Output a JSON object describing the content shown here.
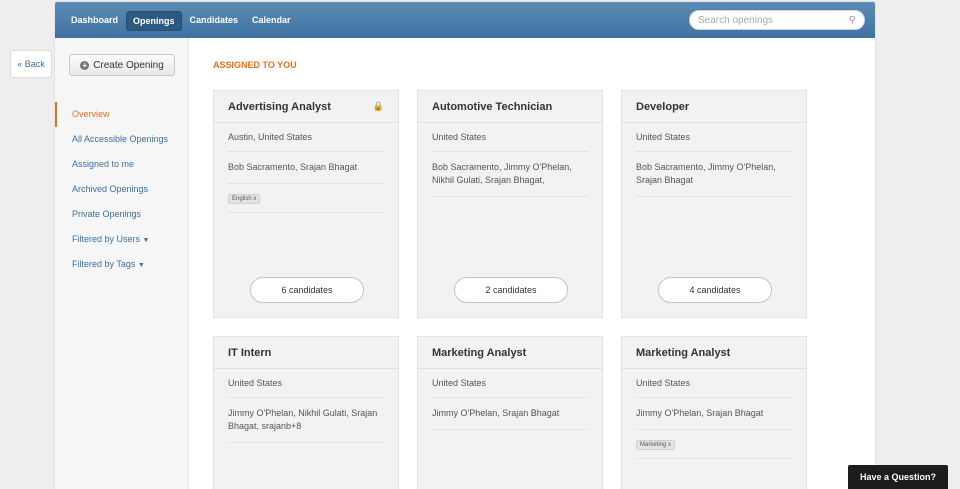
{
  "back_label": "« Back",
  "nav": {
    "items": [
      {
        "label": "Dashboard"
      },
      {
        "label": "Openings"
      },
      {
        "label": "Candidates"
      },
      {
        "label": "Calendar"
      }
    ],
    "active": "Openings",
    "search_placeholder": "Search openings"
  },
  "sidebar": {
    "create_label": "Create Opening",
    "items": [
      {
        "label": "Overview"
      },
      {
        "label": "All Accessible Openings"
      },
      {
        "label": "Assigned to me"
      },
      {
        "label": "Archived Openings"
      },
      {
        "label": "Private Openings"
      },
      {
        "label": "Filtered by Users"
      },
      {
        "label": "Filtered by Tags"
      }
    ]
  },
  "main": {
    "section_title": "ASSIGNED TO YOU",
    "cards": [
      {
        "title": "Advertising Analyst",
        "location": "Austin, United States",
        "users": "Bob Sacramento, Srajan Bhagat",
        "tag": "English x",
        "candidates": "6 candidates"
      },
      {
        "title": "Automotive Technician",
        "location": "United States",
        "users": "Bob Sacramento, Jimmy O'Phelan, Nikhil Gulati, Srajan Bhagat,",
        "candidates": "2 candidates"
      },
      {
        "title": "Developer",
        "location": "United States",
        "users": "Bob Sacramento, Jimmy O'Phelan, Srajan Bhagat",
        "candidates": "4 candidates"
      },
      {
        "title": "IT Intern",
        "location": "United States",
        "users": "Jimmy O'Phelan, Nikhil Gulati, Srajan Bhagat, srajanb+8"
      },
      {
        "title": "Marketing Analyst",
        "location": "United States",
        "users": "Jimmy O'Phelan, Srajan Bhagat"
      },
      {
        "title": "Marketing Analyst",
        "location": "United States",
        "users": "Jimmy O'Phelan, Srajan Bhagat",
        "tag": "Marketing x"
      }
    ]
  },
  "help_label": "Have a Question?"
}
